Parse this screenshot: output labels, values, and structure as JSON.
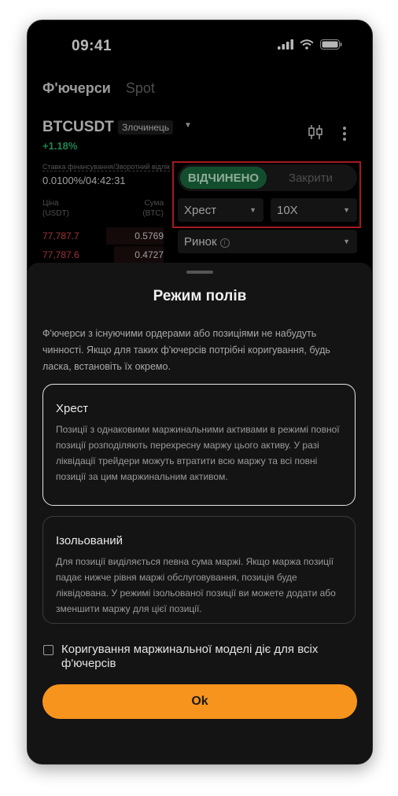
{
  "status_bar": {
    "time": "09:41"
  },
  "tabs": [
    {
      "label": "Ф'ючерси"
    },
    {
      "label": "Spot"
    }
  ],
  "ticker": {
    "symbol": "BTCUSDT",
    "badge": "Злочинець",
    "change": "+1.18%"
  },
  "funding": {
    "label": "Ставка фінансування/Зворотний відлік",
    "value": "0.0100%/04:42:31"
  },
  "orderbook": {
    "price_label": "Ціна\n(USDT)",
    "amount_label": "Сума\n(BTC)",
    "rows": [
      {
        "price": "77,787.7",
        "amount": "0.5769"
      },
      {
        "price": "77,787.6",
        "amount": "0.4727"
      }
    ]
  },
  "trade_panel": {
    "open_label": "ВІДЧИНЕНО",
    "close_label": "Закрити",
    "margin_mode": "Хрест",
    "leverage": "10X",
    "order_type": "Ринок"
  },
  "sheet": {
    "title": "Режим полів",
    "description": "Ф'ючерси з існуючими ордерами або позиціями не набудуть чинності. Якщо для таких ф'ючерсів потрібні коригування, будь ласка, встановіть їх окремо.",
    "options": [
      {
        "title": "Хрест",
        "description": "Позиції з однаковими маржинальними активами в режимі повної позиції розподіляють перехресну маржу цього активу. У разі ліквідації трейдери можуть втратити всю маржу та всі повні позиції за цим маржинальним активом.",
        "selected": true
      },
      {
        "title": "Ізольований",
        "description": "Для позиції виділяється певна сума маржі. Якщо маржа позиції падає нижче рівня маржі обслуговування, позиція буде ліквідована. У режимі ізольованої позиції ви можете додати або зменшити маржу для цієї позиції.",
        "selected": false
      }
    ],
    "checkbox_label": "Коригування маржинальної моделі діє для всіх ф'ючерсів",
    "ok_label": "Ok"
  },
  "colors": {
    "accent": "#f7941d",
    "open_green": "#1a6d3f",
    "ask_red": "#e0464b",
    "highlight": "#e3232d"
  }
}
